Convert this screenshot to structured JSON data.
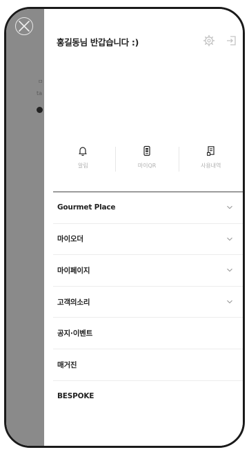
{
  "header": {
    "greeting": "홍길동님 반갑습니다 :)",
    "settings_icon": "gear-icon",
    "logout_icon": "logout-icon"
  },
  "backdrop": {
    "ghost_text_1": "ㅁ",
    "ghost_text_2": "ta"
  },
  "quick_links": [
    {
      "label": "알림",
      "icon": "bell-icon"
    },
    {
      "label": "마이QR",
      "icon": "qr-icon"
    },
    {
      "label": "사용내역",
      "icon": "receipt-icon"
    }
  ],
  "menu": [
    {
      "label": "Gourmet Place",
      "expandable": true
    },
    {
      "label": "마이오더",
      "expandable": true
    },
    {
      "label": "마이페이지",
      "expandable": true
    },
    {
      "label": "고객의소리",
      "expandable": true
    },
    {
      "label": "공지·이벤트",
      "expandable": false
    },
    {
      "label": "매거진",
      "expandable": false
    },
    {
      "label": "BESPOKE",
      "expandable": false
    }
  ],
  "colors": {
    "backdrop": "#8a8a8a",
    "frame": "#1a1a1a",
    "text": "#222222",
    "muted": "#b0b0b0"
  }
}
